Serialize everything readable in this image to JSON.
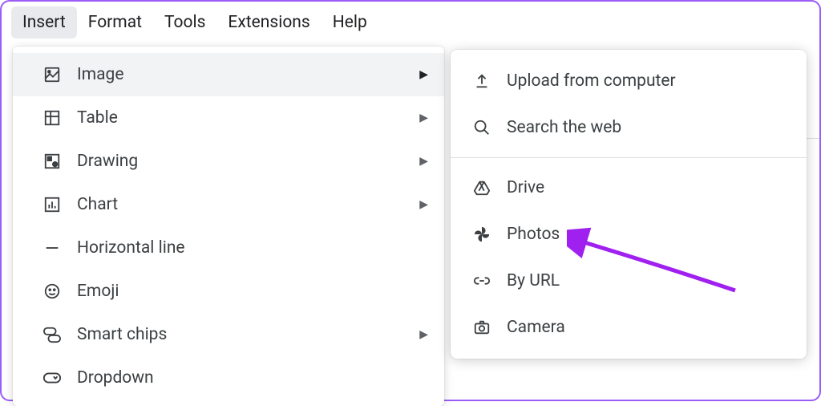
{
  "menubar": {
    "items": [
      {
        "label": "Insert",
        "active": true
      },
      {
        "label": "Format"
      },
      {
        "label": "Tools"
      },
      {
        "label": "Extensions"
      },
      {
        "label": "Help"
      }
    ]
  },
  "dropdown": {
    "items": [
      {
        "icon": "image-icon",
        "label": "Image",
        "has_submenu": true,
        "hover": true
      },
      {
        "icon": "table-icon",
        "label": "Table",
        "has_submenu": true
      },
      {
        "icon": "drawing-icon",
        "label": "Drawing",
        "has_submenu": true
      },
      {
        "icon": "chart-icon",
        "label": "Chart",
        "has_submenu": true
      },
      {
        "icon": "horizontal-line-icon",
        "label": "Horizontal line"
      },
      {
        "icon": "emoji-icon",
        "label": "Emoji"
      },
      {
        "icon": "smart-chips-icon",
        "label": "Smart chips",
        "has_submenu": true
      },
      {
        "icon": "dropdown-icon",
        "label": "Dropdown"
      }
    ]
  },
  "submenu": {
    "items": [
      {
        "icon": "upload-icon",
        "label": "Upload from computer"
      },
      {
        "icon": "search-icon",
        "label": "Search the web"
      },
      {
        "divider": true
      },
      {
        "icon": "drive-icon",
        "label": "Drive"
      },
      {
        "icon": "photos-icon",
        "label": "Photos"
      },
      {
        "icon": "link-icon",
        "label": "By URL"
      },
      {
        "icon": "camera-icon",
        "label": "Camera"
      }
    ]
  },
  "annotation": {
    "target": "Photos",
    "color": "#a020f0"
  }
}
